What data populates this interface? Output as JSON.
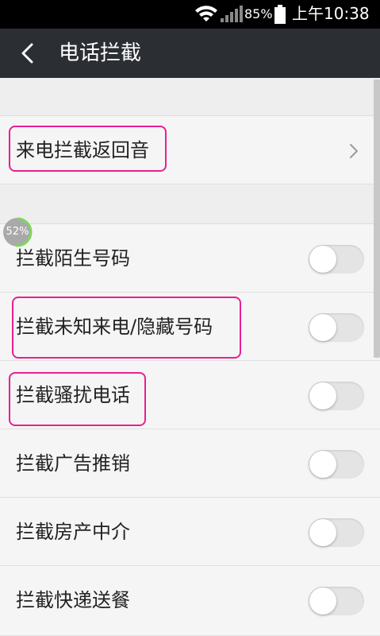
{
  "status_bar": {
    "battery_percent": "85%",
    "time": "上午10:38",
    "icons": [
      "wifi-icon",
      "signal-icon",
      "battery-icon"
    ]
  },
  "header": {
    "title": "电话拦截",
    "back_icon": "chevron-left-icon"
  },
  "items": [
    {
      "label": "来电拦截返回音",
      "control": "chevron",
      "highlighted": true
    },
    {
      "label": "拦截陌生号码",
      "control": "toggle",
      "checked": false,
      "highlighted": false
    },
    {
      "label": "拦截未知来电/隐藏号码",
      "control": "toggle",
      "checked": false,
      "highlighted": true
    },
    {
      "label": "拦截骚扰电话",
      "control": "toggle",
      "checked": false,
      "highlighted": true
    },
    {
      "label": "拦截广告推销",
      "control": "toggle",
      "checked": false,
      "highlighted": false
    },
    {
      "label": "拦截房产中介",
      "control": "toggle",
      "checked": false,
      "highlighted": false
    },
    {
      "label": "拦截快递送餐",
      "control": "toggle",
      "checked": false,
      "highlighted": false
    }
  ],
  "progress_badge": {
    "text": "52%",
    "value": 0.52
  },
  "colors": {
    "title_bar": "#2b2e33",
    "highlight": "#e8208f",
    "progress_ring": "#7dd85a",
    "background": "#f2f2f2"
  }
}
